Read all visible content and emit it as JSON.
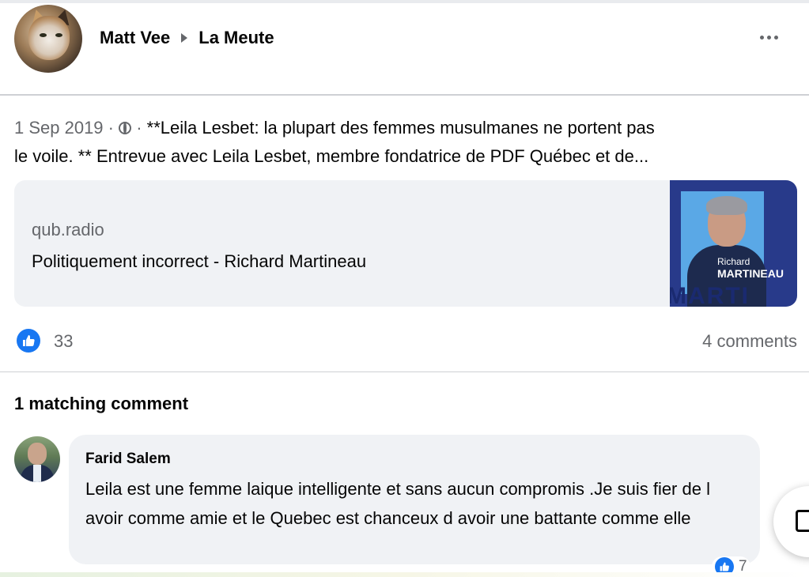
{
  "post": {
    "author": "Matt Vee",
    "group": "La Meute",
    "date": "1 Sep 2019",
    "separator": " · ",
    "text_line1": "**Leila Lesbet: la plupart des femmes musulmanes ne portent pas",
    "text_line2": "le voile. ** Entrevue avec Leila Lesbet, membre fondatrice de PDF Québec et de..."
  },
  "link": {
    "domain": "qub.radio",
    "title": "Politiquement incorrect - Richard Martineau",
    "thumb_name_small": "Richard",
    "thumb_name_big": "MARTINEAU",
    "thumb_bottom": "MARTI"
  },
  "stats": {
    "likes": "33",
    "comments": "4 comments"
  },
  "section": {
    "matching_label": "1 matching comment"
  },
  "comment": {
    "author": "Farid Salem",
    "text": "Leila est une femme laique intelligente et sans aucun compromis .Je suis fier de l avoir comme amie et le Quebec est chanceux d avoir une battante comme elle",
    "reactions": "7"
  },
  "icons": {
    "more": "more-options-icon",
    "audience": "globe-icon",
    "like": "like-icon",
    "edit": "edit-icon"
  },
  "colors": {
    "accent": "#1877f2",
    "secondary_text": "#65676b",
    "card_bg": "#f0f2f5"
  }
}
